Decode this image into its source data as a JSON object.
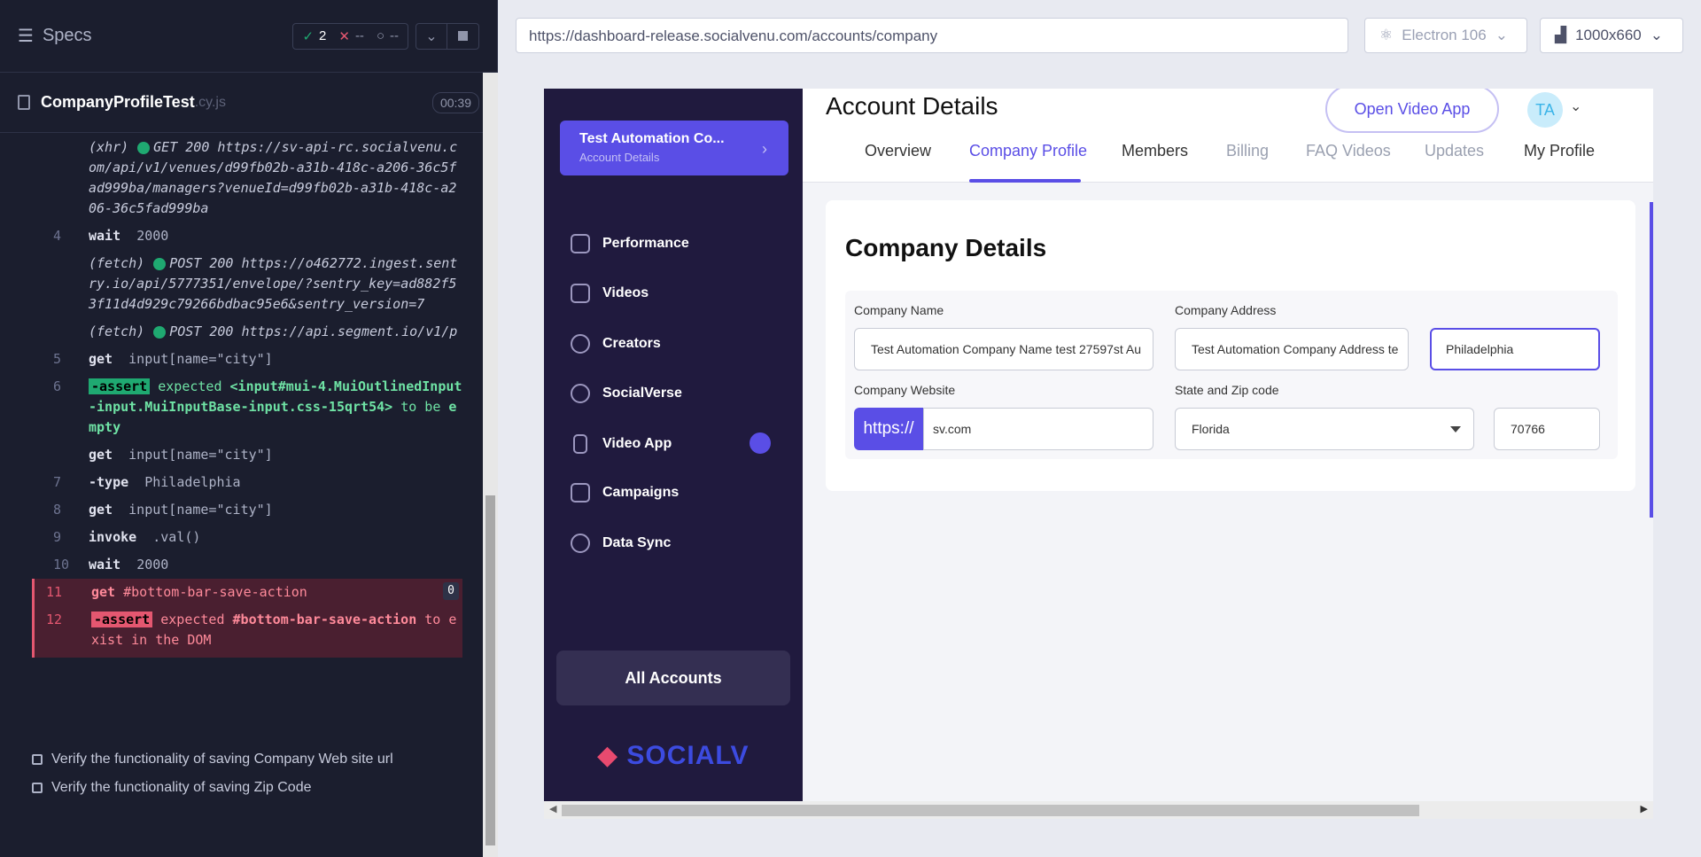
{
  "runner": {
    "specs_label": "Specs",
    "stats": {
      "passed": "2",
      "failed": "--",
      "pending": "--"
    },
    "spec_file": "CompanyProfileTest",
    "spec_ext": ".cy.js",
    "duration": "00:39",
    "commands": [
      {
        "num": "",
        "type": "xhr",
        "prefix": "(xhr)",
        "method": "GET 200",
        "url": "https://sv-api-rc.socialvenu.com/api/v1/venues/d99fb02b-a31b-418c-a206-36c5fad999ba/managers?venueId=d99fb02b-a31b-418c-a206-36c5fad999ba"
      },
      {
        "num": "4",
        "type": "cmd",
        "name": "wait",
        "arg": "2000"
      },
      {
        "num": "",
        "type": "xhr",
        "prefix": "(fetch)",
        "method": "POST 200",
        "url": "https://o462772.ingest.sentry.io/api/5777351/envelope/?sentry_key=ad882f53f11d4d929c79266bdbac95e6&sentry_version=7"
      },
      {
        "num": "",
        "type": "xhr",
        "prefix": "(fetch)",
        "method": "POST 200",
        "url": "https://api.segment.io/v1/p"
      },
      {
        "num": "5",
        "type": "cmd",
        "name": "get",
        "arg": "input[name=\"city\"]"
      },
      {
        "num": "6",
        "type": "assert",
        "name": "-assert",
        "text1": "expected",
        "text2": "<input#mui-4.MuiOutlinedInput-input.MuiInputBase-input.css-15qrt54>",
        "text3": "to be",
        "text4": "empty"
      },
      {
        "num": "",
        "type": "cmd",
        "name": "get",
        "arg": "input[name=\"city\"]"
      },
      {
        "num": "7",
        "type": "cmd",
        "name": "-type",
        "arg": "Philadelphia"
      },
      {
        "num": "8",
        "type": "cmd",
        "name": "get",
        "arg": "input[name=\"city\"]"
      },
      {
        "num": "9",
        "type": "cmd",
        "name": "invoke",
        "arg": ".val()"
      },
      {
        "num": "10",
        "type": "cmd",
        "name": "wait",
        "arg": "2000"
      },
      {
        "num": "11",
        "type": "fail",
        "name": "get",
        "arg": "#bottom-bar-save-action",
        "badge": "0"
      },
      {
        "num": "12",
        "type": "failassert",
        "name": "-assert",
        "text1": "expected",
        "text2": "#bottom-bar-save-action",
        "text3": "to exist in the DOM"
      }
    ],
    "tests": [
      "Verify the functionality of saving Company Web site url",
      "Verify the functionality of saving Zip Code"
    ]
  },
  "browser": {
    "url": "https://dashboard-release.socialvenu.com/accounts/company",
    "browser_label": "Electron 106",
    "viewport_label": "1000x660"
  },
  "app": {
    "account_card": {
      "name": "Test Automation Co...",
      "sub": "Account Details"
    },
    "nav": [
      "Performance",
      "Videos",
      "Creators",
      "SocialVerse",
      "Video App",
      "Campaigns",
      "Data Sync"
    ],
    "all_accounts": "All Accounts",
    "logo_text": "SOCIALV",
    "header_title": "Account Details",
    "open_video_app": "Open Video App",
    "avatar_initials": "TA",
    "tabs": [
      "Overview",
      "Company Profile",
      "Members",
      "Billing",
      "FAQ Videos",
      "Updates",
      "My Profile"
    ],
    "card_title": "Company Details",
    "form": {
      "company_name_label": "Company Name",
      "company_name_value": "Test Automation Company Name test 27597st Au",
      "company_address_label": "Company Address",
      "company_address_value": "Test Automation Company Address te",
      "city_value": "Philadelphia",
      "website_label": "Company Website",
      "website_prefix": "https://",
      "website_value": "sv.com",
      "state_zip_label": "State and Zip code",
      "state_value": "Florida",
      "zip_value": "70766"
    }
  }
}
